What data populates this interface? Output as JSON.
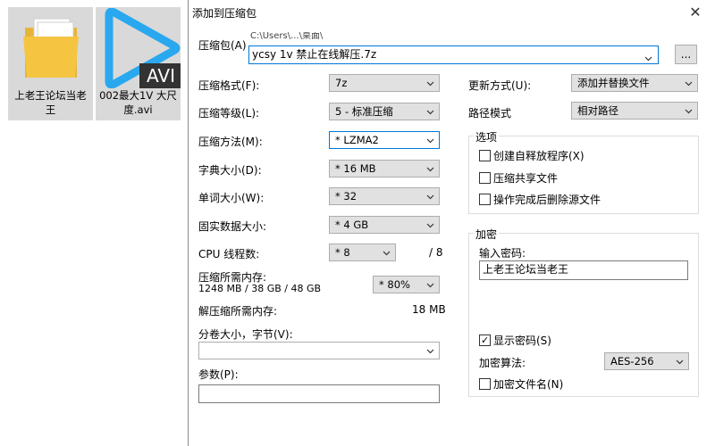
{
  "desktop": {
    "icons": [
      {
        "caption": "上老王论坛当老王",
        "icon": "folder-icon"
      },
      {
        "caption": "002最大1V 大尺度.avi",
        "icon": "video-file-icon",
        "badge": "AVI"
      }
    ]
  },
  "dialog": {
    "title": "添加到压缩包",
    "archive": {
      "label": "压缩包(A)",
      "path_hint": "C:\\Users\\...\\桌面\\",
      "value": "ycsy 1v 禁止在线解压.7z",
      "browse_label": "..."
    },
    "left": {
      "format": {
        "label": "压缩格式(F):",
        "value": "7z"
      },
      "level": {
        "label": "压缩等级(L):",
        "value": "5 - 标准压缩"
      },
      "method": {
        "label": "压缩方法(M):",
        "value": "* LZMA2"
      },
      "dict": {
        "label": "字典大小(D):",
        "value": "* 16 MB"
      },
      "word": {
        "label": "单词大小(W):",
        "value": "* 32"
      },
      "solid": {
        "label": "固实数据大小:",
        "value": "* 4 GB"
      },
      "threads": {
        "label": "CPU 线程数:",
        "value": "* 8",
        "max": "/ 8"
      },
      "mem_compress": {
        "label": "压缩所需内存:",
        "detail": "1248 MB / 38 GB / 48 GB",
        "value": "* 80%"
      },
      "mem_decompress": {
        "label": "解压缩所需内存:",
        "value": "18 MB"
      },
      "split": {
        "label": "分卷大小，字节(V):",
        "value": ""
      },
      "params": {
        "label": "参数(P):",
        "value": ""
      }
    },
    "right": {
      "update": {
        "label": "更新方式(U):",
        "value": "添加并替换文件"
      },
      "pathmode": {
        "label": "路径模式",
        "value": "相对路径"
      },
      "options": {
        "title": "选项",
        "items": [
          {
            "label": "创建自释放程序(X)",
            "checked": false
          },
          {
            "label": "压缩共享文件",
            "checked": false
          },
          {
            "label": "操作完成后删除源文件",
            "checked": false
          }
        ]
      },
      "encryption": {
        "title": "加密",
        "password_label": "输入密码:",
        "password_value": "上老王论坛当老王",
        "show_password": {
          "label": "显示密码(S)",
          "checked": true
        },
        "method_label": "加密算法:",
        "method_value": "AES-256",
        "encrypt_names": {
          "label": "加密文件名(N)",
          "checked": false
        }
      }
    }
  },
  "colors": {
    "accent": "#0078d7",
    "selected_bg": "#d9d9d9",
    "folder": "#f5c542"
  }
}
